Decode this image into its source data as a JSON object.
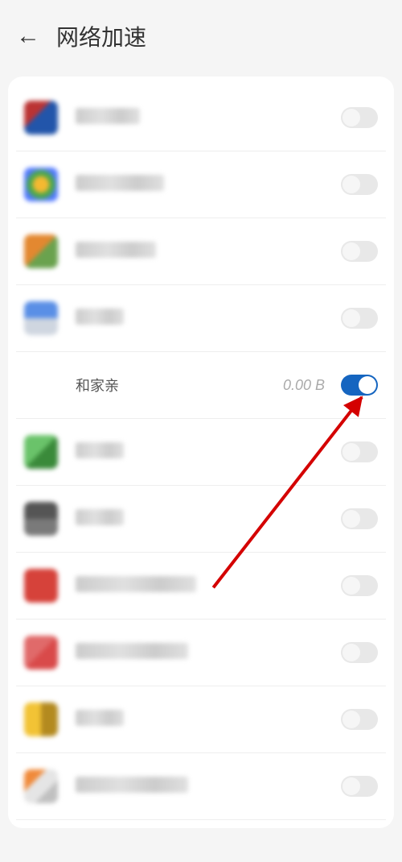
{
  "header": {
    "title": "网络加速"
  },
  "highlighted": {
    "label": "和家亲",
    "data": "0.00 B",
    "toggle": true
  },
  "rows": [
    {
      "id": "app-1",
      "icon_class": "icon1",
      "toggle": false
    },
    {
      "id": "app-2",
      "icon_class": "icon2",
      "toggle": false
    },
    {
      "id": "app-3",
      "icon_class": "icon3",
      "toggle": false
    },
    {
      "id": "app-4",
      "icon_class": "icon4",
      "toggle": false
    },
    {
      "id": "app-5",
      "icon_class": "icon5",
      "toggle": true,
      "highlight": true
    },
    {
      "id": "app-6",
      "icon_class": "icon6",
      "toggle": false
    },
    {
      "id": "app-7",
      "icon_class": "icon7",
      "toggle": false
    },
    {
      "id": "app-8",
      "icon_class": "icon8",
      "toggle": false
    },
    {
      "id": "app-9",
      "icon_class": "icon9",
      "toggle": false
    },
    {
      "id": "app-10",
      "icon_class": "icon10",
      "toggle": false
    },
    {
      "id": "app-11",
      "icon_class": "icon11",
      "toggle": false
    }
  ]
}
